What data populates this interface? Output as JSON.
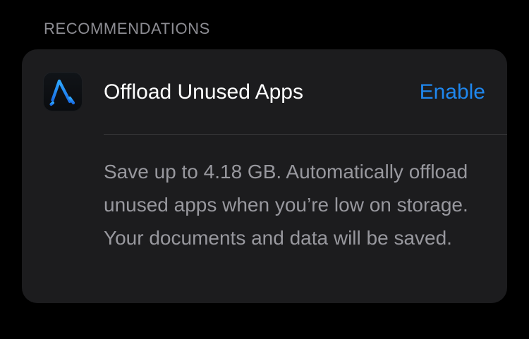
{
  "section": {
    "header": "RECOMMENDATIONS"
  },
  "recommendation": {
    "icon": "app-store-icon",
    "title": "Offload Unused Apps",
    "action_label": "Enable",
    "description": "Save up to 4.18 GB. Automatically offload unused apps when you’re low on storage. Your documents and data will be saved."
  },
  "colors": {
    "background": "#000000",
    "card": "#1c1c1e",
    "accent": "#1f87ee",
    "secondary_text": "#98989e",
    "header_text": "#8d8d93"
  }
}
